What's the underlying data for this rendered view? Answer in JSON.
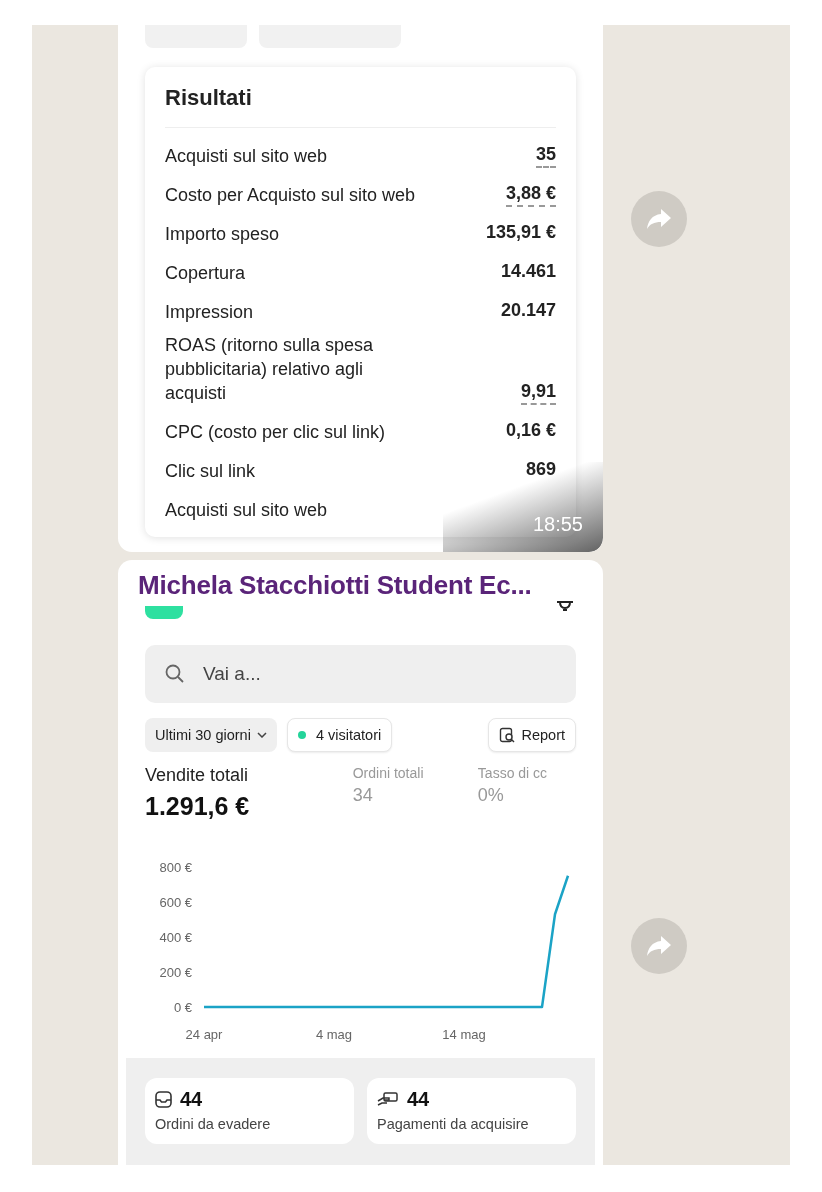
{
  "results": {
    "title": "Risultati",
    "rows": [
      {
        "label": "Acquisti sul sito web",
        "value": "35",
        "underlined": true,
        "kind": "single"
      },
      {
        "label": "Costo per Acquisto sul sito web",
        "value": "3,88 €",
        "underlined": true,
        "kind": "single"
      },
      {
        "label": "Importo speso",
        "value": "135,91 €",
        "underlined": false,
        "kind": "single"
      },
      {
        "label": "Copertura",
        "value": "14.461",
        "underlined": false,
        "kind": "single"
      },
      {
        "label": "Impression",
        "value": "20.147",
        "underlined": false,
        "kind": "single"
      },
      {
        "label": "ROAS (ritorno sulla spesa pubblicitaria) relativo agli acquisti",
        "value": "9,91",
        "underlined": true,
        "kind": "multiline"
      },
      {
        "label": "CPC (costo per clic sul link)",
        "value": "0,16 €",
        "underlined": false,
        "kind": "single"
      },
      {
        "label": "Clic sul link",
        "value": "869",
        "underlined": false,
        "kind": "single"
      },
      {
        "label": "Acquisti sul sito web",
        "kind": "single"
      }
    ]
  },
  "timestamp": "18:55",
  "sender": "Michela Stacchiotti Student Ec...",
  "dashboard": {
    "search": {
      "placeholder": "Vai a..."
    },
    "period": "Ultimi 30 giorni",
    "visitors": "4 visitatori",
    "report": "Report",
    "stats": [
      {
        "label": "Vendite totali",
        "value": "1.291,6 €",
        "kind": "main"
      },
      {
        "label": "Ordini totali",
        "value": "34",
        "kind": "minor"
      },
      {
        "label": "Tasso di cc",
        "value": "0%",
        "kind": "minor"
      }
    ],
    "chart_data": {
      "type": "line",
      "categories": [
        "24 apr",
        null,
        null,
        null,
        null,
        null,
        null,
        null,
        null,
        null,
        "4 mag",
        null,
        null,
        null,
        null,
        null,
        null,
        null,
        null,
        null,
        "14 mag",
        null,
        null,
        null,
        null,
        null,
        null,
        null,
        null
      ],
      "series": [
        {
          "color": "#1ba3c6",
          "values": [
            0,
            0,
            0,
            0,
            0,
            0,
            0,
            0,
            0,
            0,
            0,
            0,
            0,
            0,
            0,
            0,
            0,
            0,
            0,
            0,
            0,
            0,
            0,
            0,
            0,
            0,
            0,
            530,
            750
          ]
        }
      ],
      "ylim": [
        0,
        800
      ],
      "yticks": [
        {
          "value": 0,
          "label": "0 €"
        },
        {
          "value": 200,
          "label": "200 €"
        },
        {
          "value": 400,
          "label": "400 €"
        },
        {
          "value": 600,
          "label": "600 €"
        },
        {
          "value": 800,
          "label": "800 €"
        }
      ]
    },
    "tasks": [
      {
        "value": "44",
        "label": "Ordini da evadere",
        "kind": "orders"
      },
      {
        "value": "44",
        "label": "Pagamenti da acquisire",
        "kind": "payments"
      }
    ]
  }
}
